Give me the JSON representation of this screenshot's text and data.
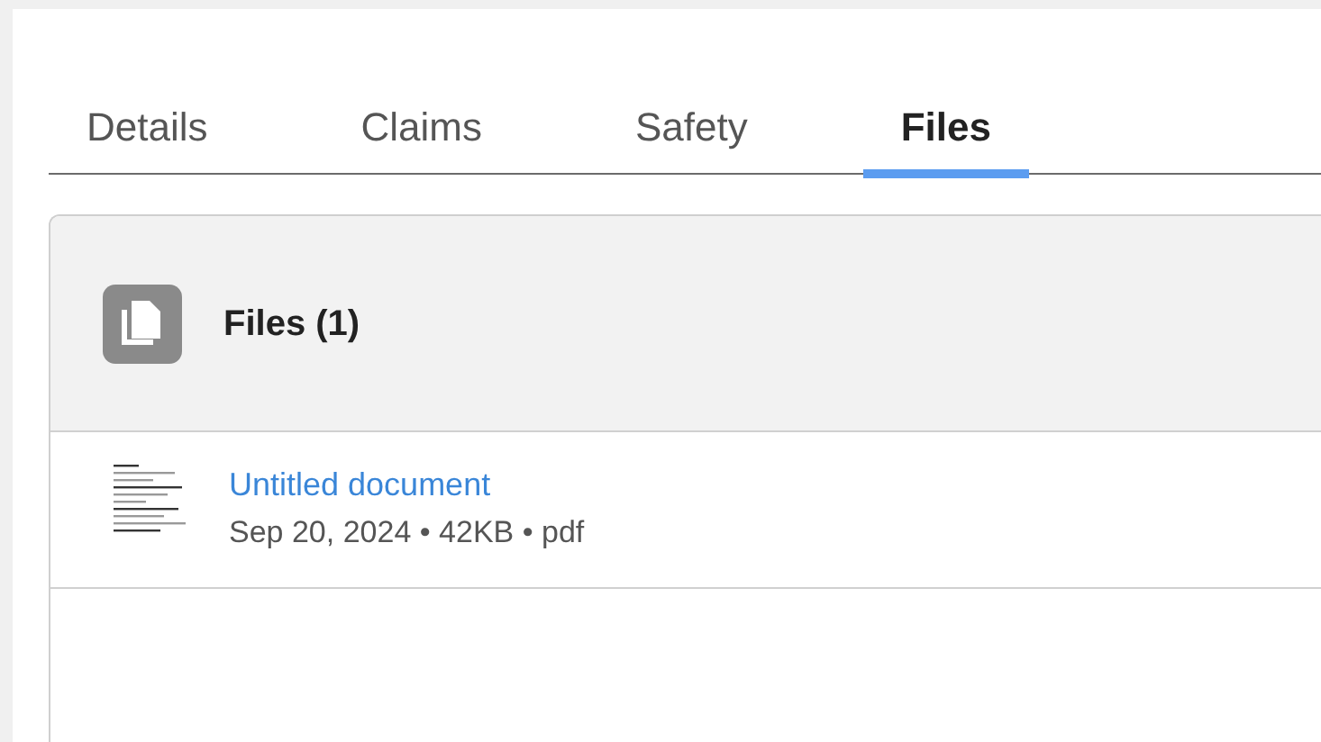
{
  "tabs": [
    {
      "label": "Details",
      "selected": false
    },
    {
      "label": "Claims",
      "selected": false
    },
    {
      "label": "Safety",
      "selected": false
    },
    {
      "label": "Files",
      "selected": true
    }
  ],
  "files_panel": {
    "title": "Files (1)",
    "files": [
      {
        "name": "Untitled document",
        "meta": "Sep 20, 2024 • 42KB • pdf"
      }
    ]
  }
}
